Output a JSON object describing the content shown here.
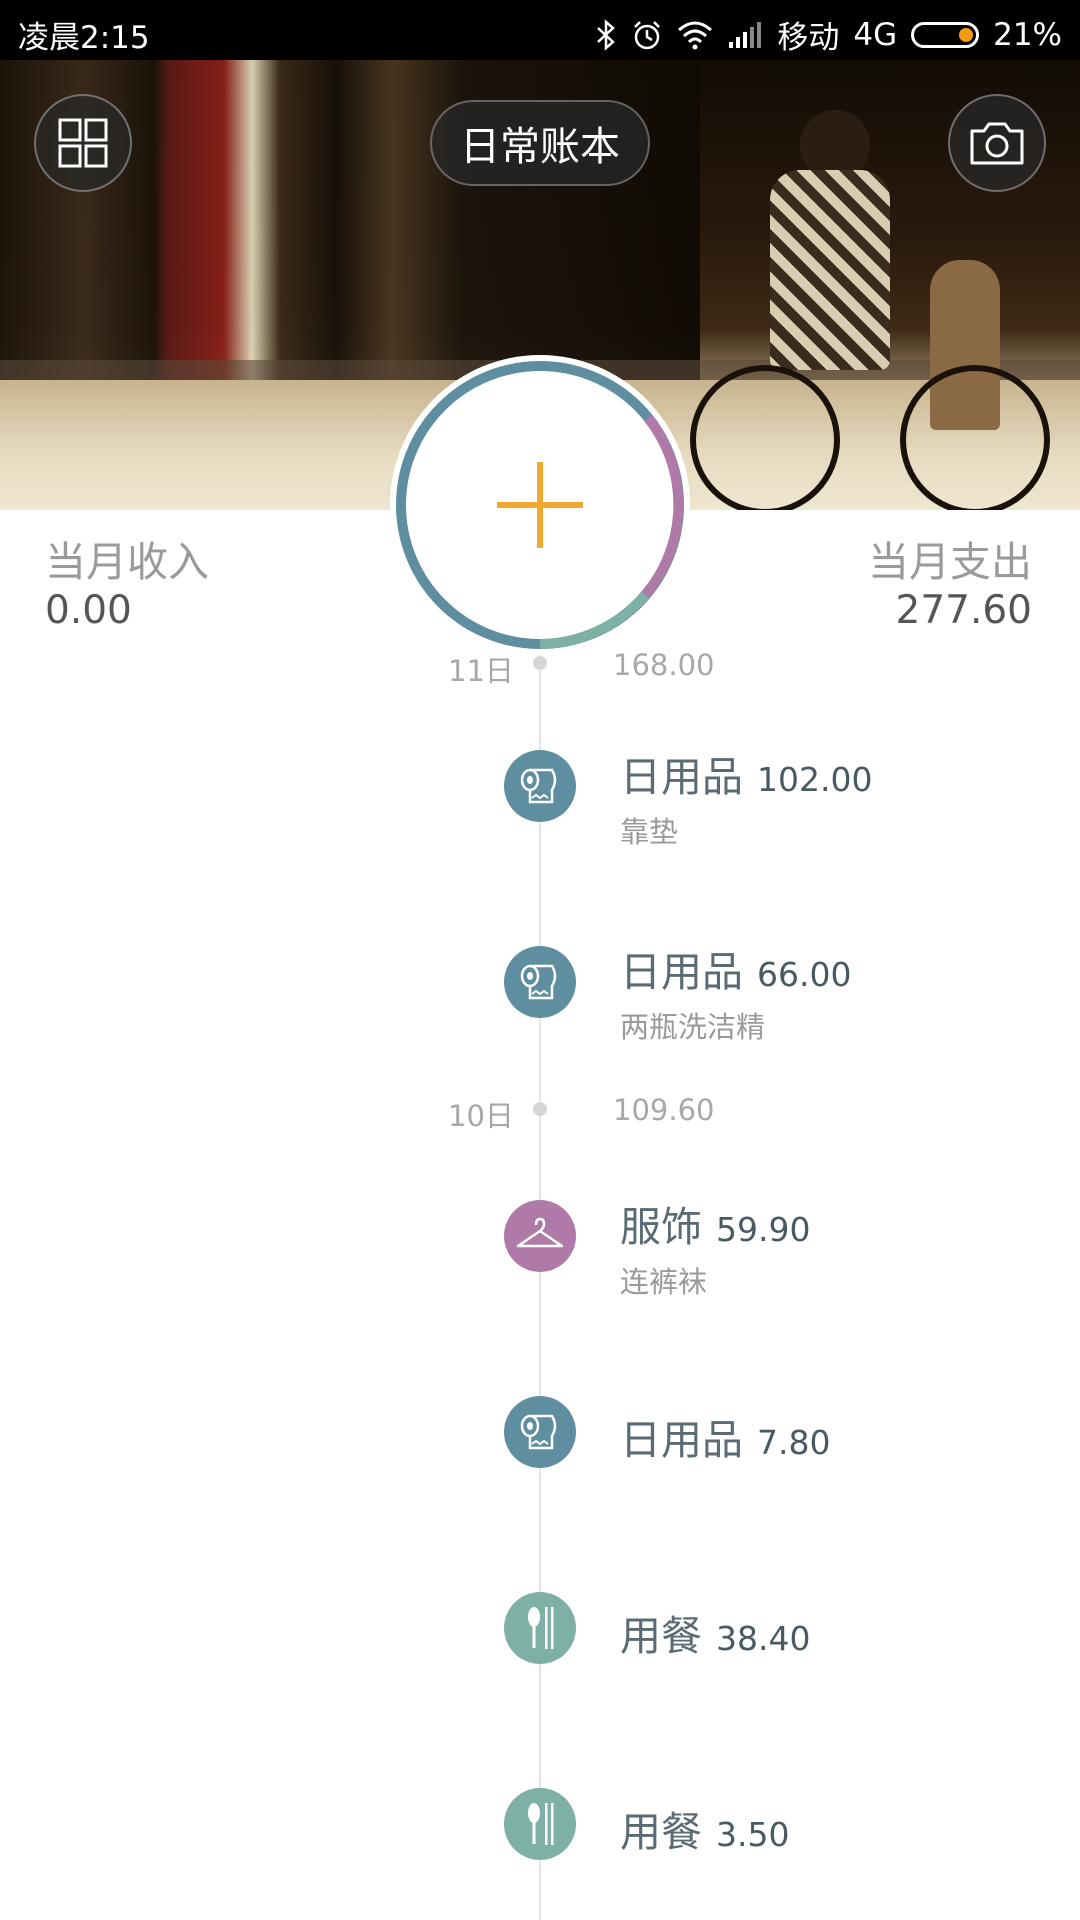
{
  "status_bar": {
    "time": "凌晨2:15",
    "carrier": "移动",
    "network": "4G",
    "battery": "21%",
    "icons": [
      "bluetooth-icon",
      "alarm-icon",
      "wifi-icon",
      "signal-icon",
      "battery-icon"
    ]
  },
  "header": {
    "book_title": "日常账本",
    "left_button_icon": "grid-icon",
    "right_button_icon": "camera-icon"
  },
  "summary": {
    "income_label": "当月收入",
    "income_value": "0.00",
    "expense_label": "当月支出",
    "expense_value": "277.60"
  },
  "add_button": {
    "icon": "plus-icon",
    "accent_color": "#f0a830",
    "ring_colors": [
      "#5f8ea0",
      "#b07aa8",
      "#7fb0a6"
    ]
  },
  "timeline": {
    "days": [
      {
        "date": "11日",
        "total": "168.00",
        "entries": [
          {
            "category": "日用品",
            "amount": "102.00",
            "note": "靠垫",
            "icon": "toilet-paper-icon",
            "color": "#5f8ea0"
          },
          {
            "category": "日用品",
            "amount": "66.00",
            "note": "两瓶洗洁精",
            "icon": "toilet-paper-icon",
            "color": "#5f8ea0"
          }
        ]
      },
      {
        "date": "10日",
        "total": "109.60",
        "entries": [
          {
            "category": "服饰",
            "amount": "59.90",
            "note": "连裤袜",
            "icon": "hanger-icon",
            "color": "#b07aa8"
          },
          {
            "category": "日用品",
            "amount": "7.80",
            "note": "",
            "icon": "toilet-paper-icon",
            "color": "#5f8ea0"
          },
          {
            "category": "用餐",
            "amount": "38.40",
            "note": "",
            "icon": "cutlery-icon",
            "color": "#7fb0a6"
          },
          {
            "category": "用餐",
            "amount": "3.50",
            "note": "",
            "icon": "cutlery-icon",
            "color": "#7fb0a6"
          }
        ]
      }
    ]
  }
}
